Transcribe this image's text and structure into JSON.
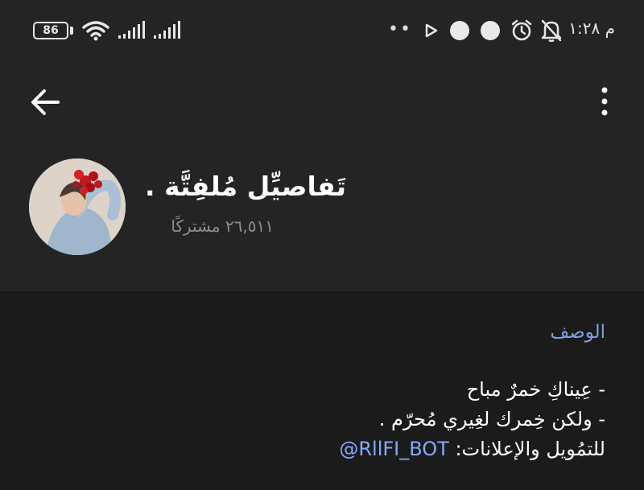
{
  "status_bar": {
    "battery": "86",
    "time": "١:٢٨",
    "am_pm": "م",
    "more_dots": "••"
  },
  "channel": {
    "title": "تَفاصيِّل مُلفِتَّة .",
    "subscribers": "٢٦,٥١١ مشتركًا"
  },
  "description": {
    "label": "الوصف",
    "line1": "- عِيناكِ خمرٌ مباح",
    "line2": "- ولكن خِمرك لغِيري مُحرّم .",
    "line3_prefix": "للتمُويل والإعلانات: ",
    "bot": "RllFI_BOT@"
  },
  "colors": {
    "background": "#1b1b1b",
    "header_background": "#242424",
    "accent_link": "#87a8ff",
    "label_blue": "#7fa0e0",
    "muted_text": "#8d8d8d"
  },
  "icons": [
    "back-arrow-icon",
    "more-vert-icon",
    "wifi-icon",
    "signal-icon",
    "play-icon",
    "alarm-icon",
    "bell-off-icon"
  ]
}
